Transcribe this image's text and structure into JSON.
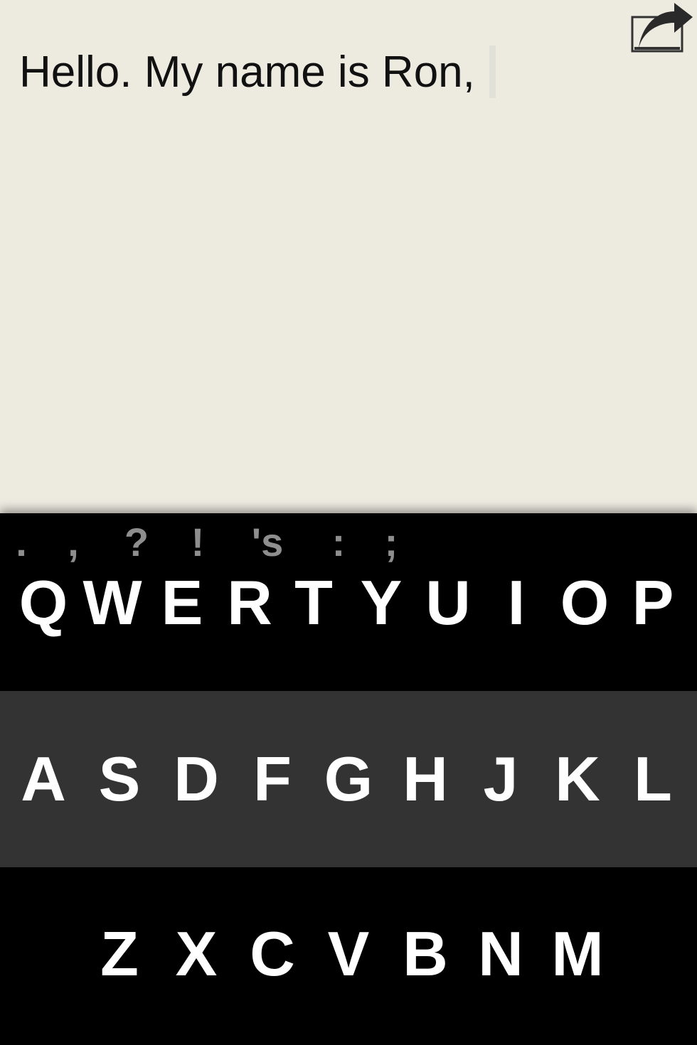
{
  "editor": {
    "text": "Hello. My name is Ron,"
  },
  "toolbar": {
    "share_icon": "share-arrow-icon"
  },
  "keyboard": {
    "punctuation": [
      ".",
      ",",
      "?",
      "!",
      "'s",
      ":",
      ";"
    ],
    "row1": [
      "Q",
      "W",
      "E",
      "R",
      "T",
      "Y",
      "U",
      "I",
      "O",
      "P"
    ],
    "row2": [
      "A",
      "S",
      "D",
      "F",
      "G",
      "H",
      "J",
      "K",
      "L"
    ],
    "row3": [
      "Z",
      "X",
      "C",
      "V",
      "B",
      "N",
      "M"
    ]
  },
  "colors": {
    "editor_background": "#edebe0",
    "text": "#111111",
    "keyboard_dark": "#000000",
    "keyboard_mid": "#333333",
    "key_label": "#ffffff",
    "punctuation_label": "#8e8e8e"
  }
}
